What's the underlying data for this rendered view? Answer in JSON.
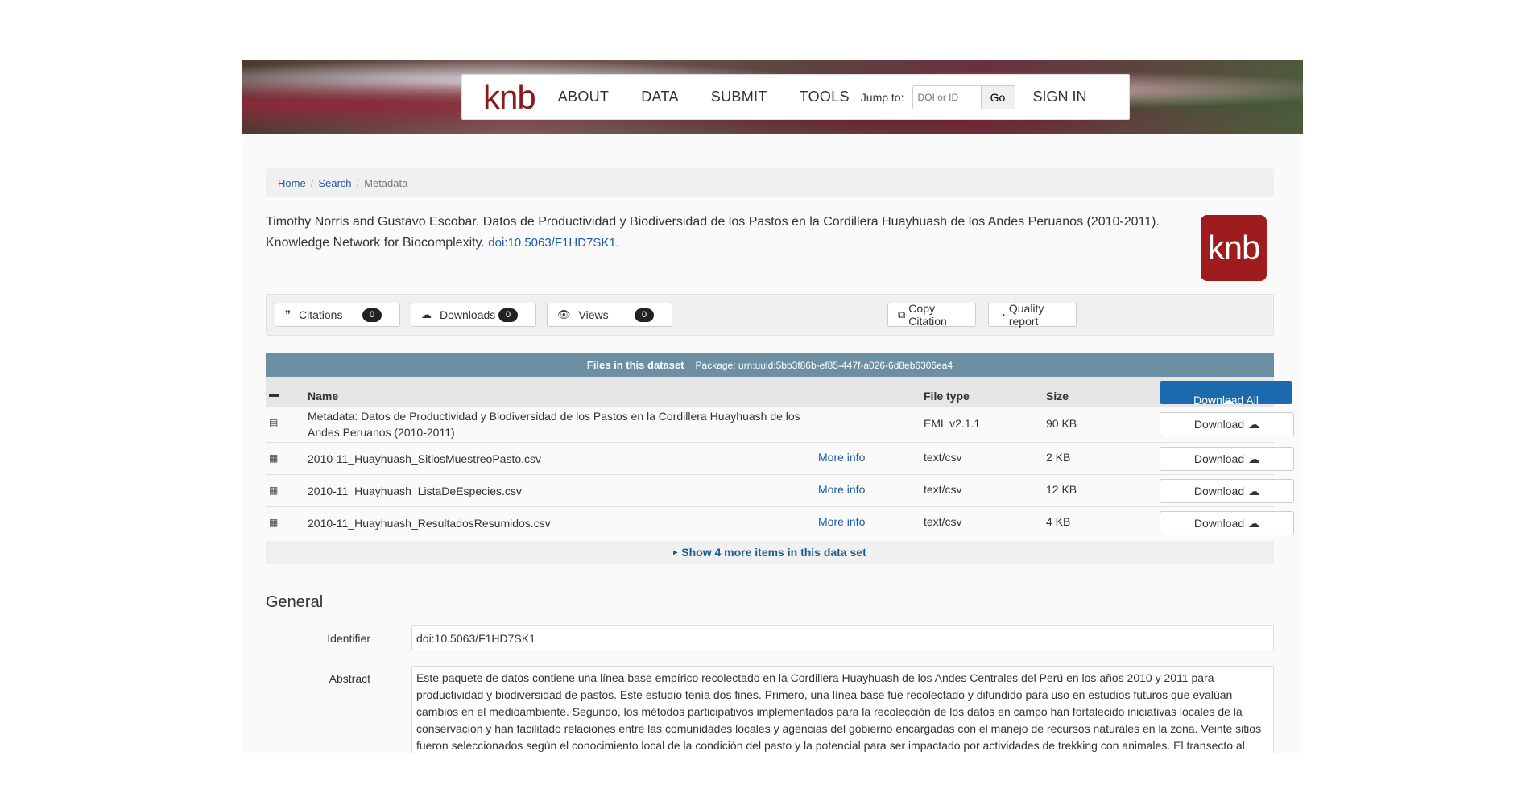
{
  "nav": {
    "logo": "knb",
    "links": [
      "ABOUT",
      "DATA",
      "SUBMIT",
      "TOOLS"
    ],
    "jump_label": "Jump to:",
    "jump_placeholder": "DOI or ID",
    "go_label": "Go",
    "signin": "SIGN IN"
  },
  "breadcrumb": {
    "home": "Home",
    "search": "Search",
    "current": "Metadata",
    "sep": "/"
  },
  "citation": {
    "text": "Timothy Norris and Gustavo Escobar. Datos de Productividad y Biodiversidad de los Pastos en la Cordillera Huayhuash de los Andes Peruanos (2010-2011). Knowledge Network for Biocomplexity.",
    "doi": "doi:10.5063/F1HD7SK1.",
    "badge_logo": "knb"
  },
  "metrics": {
    "citations_label": "Citations",
    "citations_count": "0",
    "downloads_label": "Downloads",
    "downloads_count": "0",
    "views_label": "Views",
    "views_count": "0",
    "copy_citation": "Copy Citation",
    "quality_report": "Quality report"
  },
  "files": {
    "header_title": "Files in this dataset",
    "package": "Package: urn:uuid:5bb3f86b-ef85-447f-a026-6d8eb6306ea4",
    "col_name": "Name",
    "col_type": "File type",
    "col_size": "Size",
    "download_all": "Download All",
    "download_label": "Download",
    "more_info": "More info",
    "rows": [
      {
        "name": "Metadata: Datos de Productividad y Biodiversidad de los Pastos en la Cordillera Huayhuash de los Andes Peruanos (2010-2011)",
        "type": "EML v2.1.1",
        "size": "90 KB"
      },
      {
        "name": "2010-11_Huayhuash_SitiosMuestreoPasto.csv",
        "type": "text/csv",
        "size": "2 KB"
      },
      {
        "name": "2010-11_Huayhuash_ListaDeEspecies.csv",
        "type": "text/csv",
        "size": "12 KB"
      },
      {
        "name": "2010-11_Huayhuash_ResultadosResumidos.csv",
        "type": "text/csv",
        "size": "4 KB"
      }
    ],
    "show_more": "Show 4 more items in this data set"
  },
  "general": {
    "title": "General",
    "identifier_label": "Identifier",
    "identifier_value": "doi:10.5063/F1HD7SK1",
    "abstract_label": "Abstract",
    "abstract_value": "Este paquete de datos contiene una línea base empírico recolectado en la Cordillera Huayhuash de los Andes Centrales del Perú en los años 2010 y 2011 para productividad y biodiversidad de pastos. Este estudio tenía dos fines. Primero, una línea base fue recolectado y difundido para uso en estudios futuros que evalúan cambios en el medioambiente. Segundo, los métodos participativos implementados para la recolección de los datos en campo han fortalecido iniciativas locales de la conservación y han facilitado relaciones entre las comunidades locales y agencias del gobierno encargadas con el manejo de recursos naturales en la zona. Veinte sitios fueron seleccionados según el conocimiento local de la condición del pasto y la potencial para ser impactado por actividades de trekking con animales. El transecto al"
  },
  "colors": {
    "brand": "#9e1b1e",
    "link": "#1d5aa7",
    "files_header": "#6c8fa3",
    "download_all": "#1a6aad"
  }
}
